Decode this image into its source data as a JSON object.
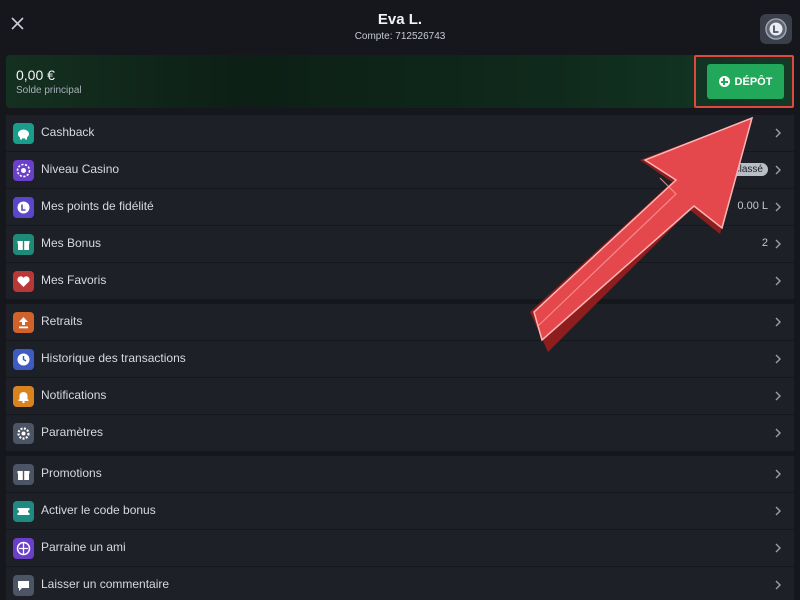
{
  "header": {
    "name": "Eva L.",
    "account": "Compte: 712526743"
  },
  "balance": {
    "amount": "0,00 €",
    "label": "Solde principal",
    "deposit_label": "DÉPÔT"
  },
  "colors": {
    "accent_green": "#22a85a",
    "highlight_red": "#e2463f"
  },
  "menu": {
    "items": [
      {
        "label": "Cashback",
        "icon": "piggy-bank-icon",
        "color": "#1a9e8c",
        "value": ""
      },
      {
        "label": "Niveau Casino",
        "icon": "casino-chip-icon",
        "color": "#6a3fc9",
        "badge": "classé"
      },
      {
        "label": "Mes points de fidélité",
        "icon": "loyalty-coin-icon",
        "color": "#5b45c8",
        "value": "0.00 L"
      },
      {
        "label": "Mes Bonus",
        "icon": "gift-icon",
        "color": "#1f8a78",
        "value": "2"
      },
      {
        "label": "Mes Favoris",
        "icon": "heart-icon",
        "color": "#b83838",
        "value": ""
      },
      {
        "label": "Retraits",
        "icon": "withdraw-icon",
        "color": "#d0622a",
        "value": ""
      },
      {
        "label": "Historique des transactions",
        "icon": "clock-icon",
        "color": "#3d5bc2",
        "value": ""
      },
      {
        "label": "Notifications",
        "icon": "bell-icon",
        "color": "#d8831e",
        "value": ""
      },
      {
        "label": "Paramètres",
        "icon": "gear-icon",
        "color": "#4c5566",
        "value": ""
      },
      {
        "label": "Promotions",
        "icon": "promo-gift-icon",
        "color": "#4c5566",
        "value": ""
      },
      {
        "label": "Activer le code bonus",
        "icon": "ticket-icon",
        "color": "#1f8a82",
        "value": ""
      },
      {
        "label": "Parraine un ami",
        "icon": "referral-icon",
        "color": "#6a3fc9",
        "value": ""
      },
      {
        "label": "Laisser un commentaire",
        "icon": "chat-bubble-icon",
        "color": "#4c5566",
        "value": ""
      }
    ]
  }
}
